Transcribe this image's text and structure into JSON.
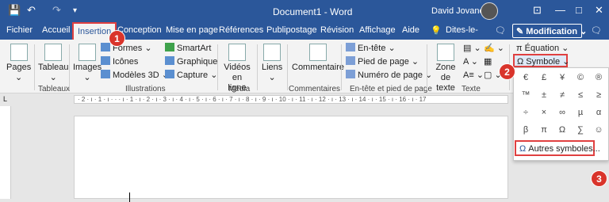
{
  "title_bar": {
    "document_title": "Document1  -  Word",
    "user_name": "David Jovanovic"
  },
  "tabs": [
    {
      "label": "Fichier"
    },
    {
      "label": "Accueil"
    },
    {
      "label": "Insertion"
    },
    {
      "label": "Conception"
    },
    {
      "label": "Mise en page"
    },
    {
      "label": "Références"
    },
    {
      "label": "Publipostage"
    },
    {
      "label": "Révision"
    },
    {
      "label": "Affichage"
    },
    {
      "label": "Aide"
    },
    {
      "label": "Dites-le-"
    }
  ],
  "mode_button": {
    "label": "Modification",
    "chevron": "⌄"
  },
  "ribbon": {
    "pages": {
      "label": "Pages"
    },
    "tableau": {
      "label": "Tableau",
      "group": "Tableaux"
    },
    "illustrations": {
      "images": "Images",
      "formes": "Formes",
      "icones": "Icônes",
      "modeles3d": "Modèles 3D",
      "smartart": "SmartArt",
      "graphique": "Graphique",
      "capture": "Capture",
      "group": "Illustrations"
    },
    "media": {
      "videos": "Vidéos en ligne",
      "group": "Média"
    },
    "liens": {
      "label": "Liens"
    },
    "commentaires": {
      "commentaire": "Commentaire",
      "group": "Commentaires"
    },
    "entete": {
      "entete": "En-tête",
      "pied": "Pied de page",
      "numero": "Numéro de page",
      "group": "En-tête et pied de page"
    },
    "texte": {
      "zone": "Zone de texte",
      "group": "Texte"
    },
    "symboles": {
      "equation": "Équation",
      "symbole": "Symbole"
    }
  },
  "ruler_text": "· 2 · ı · 1 · ı · ·   · ı · 1 · ı · 2 · ı · 3 · ı · 4 · ı · 5 · ı · 6 · ı · 7 · ı · 8 · ı · 9 · ı · 10 · ı · 11 · ı · 12 · ı · 13 · ı · 14 · ı · 15 · ı · 16 · ı · 17",
  "symbols": [
    "€",
    "£",
    "¥",
    "©",
    "®",
    "™",
    "±",
    "≠",
    "≤",
    "≥",
    "÷",
    "×",
    "∞",
    "µ",
    "α",
    "β",
    "π",
    "Ω",
    "∑",
    "☺"
  ],
  "more_symbols": "Autres symboles...",
  "badges": [
    "1",
    "2",
    "3"
  ]
}
